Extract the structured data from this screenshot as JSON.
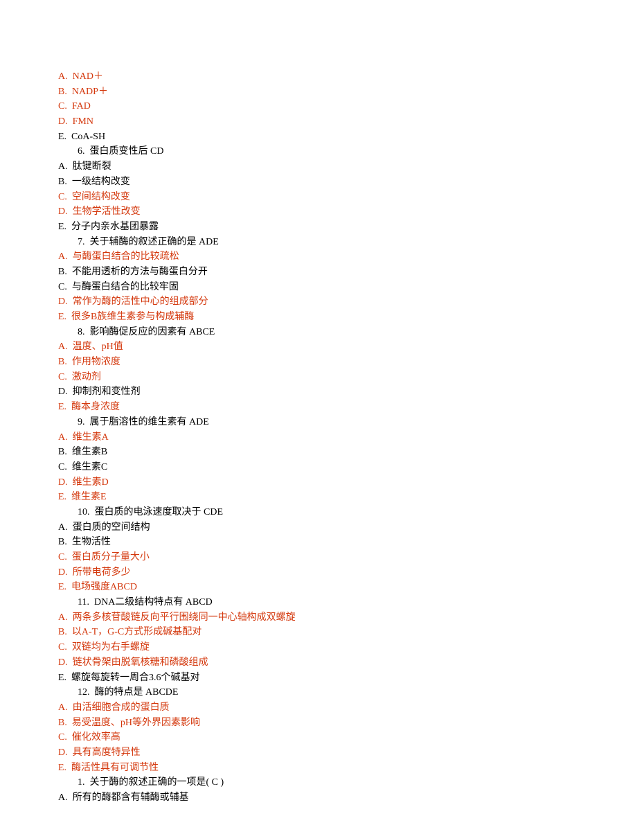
{
  "lines": [
    {
      "cls": "line red",
      "text": "A.  NAD＋"
    },
    {
      "cls": "line red",
      "text": "B.  NADP＋"
    },
    {
      "cls": "line red",
      "text": "C.  FAD"
    },
    {
      "cls": "line red",
      "text": "D.  FMN"
    },
    {
      "cls": "line",
      "text": "E.  CoA-SH",
      "font": "times"
    },
    {
      "cls": "line q-line",
      "text": "6.  蛋白质变性后 CD"
    },
    {
      "cls": "line",
      "text": "A.  肽键断裂"
    },
    {
      "cls": "line",
      "text": "B.  一级结构改变"
    },
    {
      "cls": "line red",
      "text": "C.  空间结构改变"
    },
    {
      "cls": "line red",
      "text": "D.  生物学活性改变"
    },
    {
      "cls": "line",
      "text": "E.  分子内亲水基团暴露"
    },
    {
      "cls": "line q-line",
      "text": "7.  关于辅酶的叙述正确的是 ADE"
    },
    {
      "cls": "line red",
      "text": "A.  与酶蛋白结合的比较疏松"
    },
    {
      "cls": "line",
      "text": "B.  不能用透析的方法与酶蛋白分开"
    },
    {
      "cls": "line",
      "text": "C.  与酶蛋白结合的比较牢固"
    },
    {
      "cls": "line red",
      "text": "D.  常作为酶的活性中心的组成部分"
    },
    {
      "cls": "line red",
      "text": "E.  很多B族维生素参与构成辅酶"
    },
    {
      "cls": "line q-line",
      "text": "8.  影响酶促反应的因素有 ABCE"
    },
    {
      "cls": "line red",
      "text": "A.  温度、pH值"
    },
    {
      "cls": "line red",
      "text": "B.  作用物浓度"
    },
    {
      "cls": "line red",
      "text": "C.  激动剂"
    },
    {
      "cls": "line",
      "text": "D.  抑制剂和变性剂"
    },
    {
      "cls": "line red",
      "text": "E.  酶本身浓度"
    },
    {
      "cls": "line q-line",
      "text": "9.  属于脂溶性的维生素有 ADE"
    },
    {
      "cls": "line red",
      "text": "A.  维生素A"
    },
    {
      "cls": "line",
      "text": "B.  维生素B"
    },
    {
      "cls": "line",
      "text": "C.  维生素C"
    },
    {
      "cls": "line red",
      "text": "D.  维生素D"
    },
    {
      "cls": "line red",
      "text": "E.  维生素E"
    },
    {
      "cls": "line q-line",
      "text": "10.  蛋白质的电泳速度取决于 CDE"
    },
    {
      "cls": "line",
      "text": "A.  蛋白质的空间结构"
    },
    {
      "cls": "line",
      "text": "B.  生物活性"
    },
    {
      "cls": "line red",
      "text": "C.  蛋白质分子量大小"
    },
    {
      "cls": "line red",
      "text": "D.  所带电荷多少"
    },
    {
      "cls": "line red",
      "text": "E.  电场强度ABCD"
    },
    {
      "cls": "line q-line",
      "text": "11.  DNA二级结构特点有 ABCD"
    },
    {
      "cls": "line red",
      "text": "A.  两条多核苷酸链反向平行围绕同一中心轴构成双螺旋"
    },
    {
      "cls": "line red",
      "text": "B.  以A-T，G-C方式形成碱基配对"
    },
    {
      "cls": "line red",
      "text": "C.  双链均为右手螺旋"
    },
    {
      "cls": "line red",
      "text": "D.  链状骨架由脱氧核糖和磷酸组成"
    },
    {
      "cls": "line",
      "text": "E.  螺旋每旋转一周合3.6个碱基对"
    },
    {
      "cls": "line q-line",
      "text": "12.  酶的特点是 ABCDE"
    },
    {
      "cls": "line red",
      "text": "A.  由活细胞合成的蛋白质"
    },
    {
      "cls": "line red",
      "text": "B.  易受温度、pH等外界因素影响"
    },
    {
      "cls": "line red",
      "text": "C.  催化效率高"
    },
    {
      "cls": "line red",
      "text": "D.  具有高度特异性"
    },
    {
      "cls": "line red",
      "text": "E.  酶活性具有可调节性"
    },
    {
      "cls": "line q-line",
      "text": "1.  关于酶的叙述正确的一项是( C )"
    },
    {
      "cls": "line",
      "text": "A.  所有的酶都含有辅酶或辅基"
    }
  ]
}
